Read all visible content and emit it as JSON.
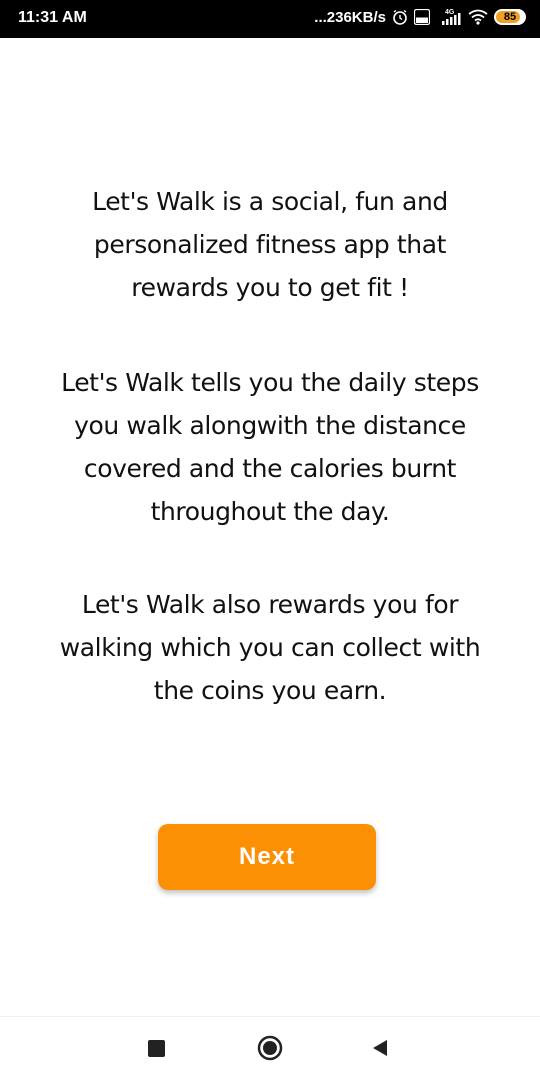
{
  "status_bar": {
    "time": "11:31 AM",
    "net_speed": "...236KB/s",
    "network_label": "4G",
    "volte_label": "Vo LTE",
    "battery_level": "85"
  },
  "intro": {
    "paragraph1": "Let's Walk is a social, fun and personalized fitness app that rewards you to get fit !",
    "paragraph2": "Let's Walk tells you the daily steps you walk alongwith the distance covered and the calories burnt throughout the day.",
    "paragraph3": "Let's Walk also rewards you for walking which you can collect with the coins you earn."
  },
  "actions": {
    "next_label": "Next"
  },
  "colors": {
    "accent": "#fc9004",
    "status_bar_bg": "#000000"
  },
  "nav": {
    "icons": [
      "recents-icon",
      "home-icon",
      "back-icon"
    ]
  }
}
